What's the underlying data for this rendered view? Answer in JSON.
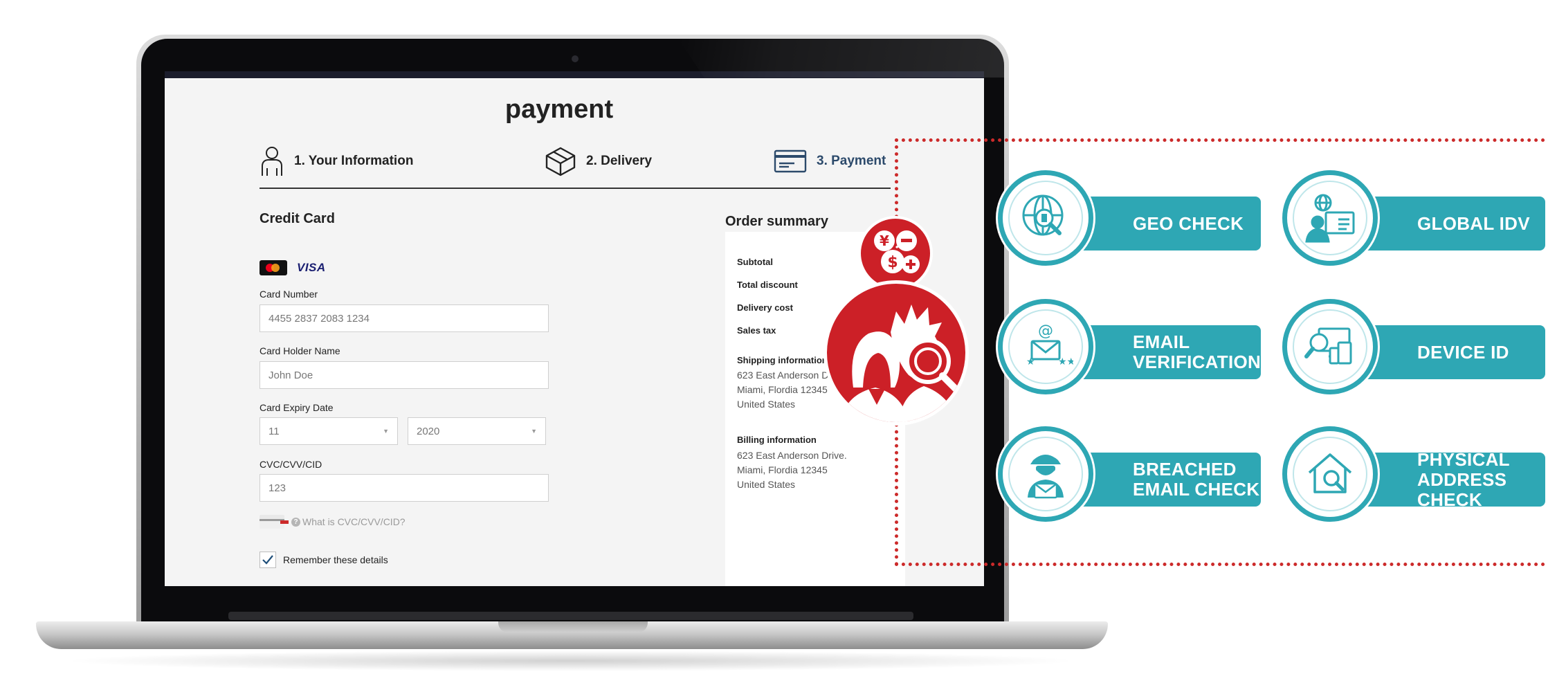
{
  "payment_page": {
    "title": "payment",
    "steps": [
      {
        "label": "1. Your Information",
        "icon": "user-icon"
      },
      {
        "label": "2. Delivery",
        "icon": "box-icon"
      },
      {
        "label": "3. Payment",
        "icon": "credit-card-icon",
        "active": true
      }
    ],
    "credit_card": {
      "section_title": "Credit Card",
      "card_brands": [
        "mastercard-logo",
        "VISA"
      ],
      "card_number_label": "Card Number",
      "card_number_value": "4455 2837 2083 1234",
      "holder_label": "Card Holder Name",
      "holder_value": "John Doe",
      "expiry_label": "Card Expiry Date",
      "expiry_month": "11",
      "expiry_year": "2020",
      "cvc_label": "CVC/CVV/CID",
      "cvc_value": "123",
      "cvc_help": "What is CVC/CVV/CID?",
      "remember_label": "Remember these details",
      "remember_checked": true
    },
    "order_summary": {
      "title": "Order summary",
      "rows": [
        "Subtotal",
        "Total discount",
        "Delivery cost",
        "Sales tax"
      ],
      "shipping_label": "Shipping information",
      "shipping_lines": [
        "623 East Anderson D",
        "Miami, Flordia 12345",
        "United States"
      ],
      "billing_label": "Billing information",
      "billing_lines": [
        "623 East Anderson Drive.",
        "Miami, Flordia 12345",
        "United States"
      ]
    }
  },
  "overlay": {
    "accent_red": "#cc2027",
    "teal": "#2ea7b4",
    "small_badge_icon": "currency-exchange-icon",
    "big_badge_icon": "identity-search-icon"
  },
  "features": [
    {
      "label": "GEO CHECK",
      "icon": "globe-search-icon"
    },
    {
      "label": "GLOBAL IDV",
      "icon": "global-id-card-icon"
    },
    {
      "label": "EMAIL\nVERIFICATION",
      "icon": "email-verification-icon"
    },
    {
      "label": "DEVICE ID",
      "icon": "device-search-icon"
    },
    {
      "label": "BREACHED\nEMAIL CHECK",
      "icon": "spy-email-icon"
    },
    {
      "label": "PHYSICAL\nADDRESS CHECK",
      "icon": "house-search-icon"
    }
  ]
}
